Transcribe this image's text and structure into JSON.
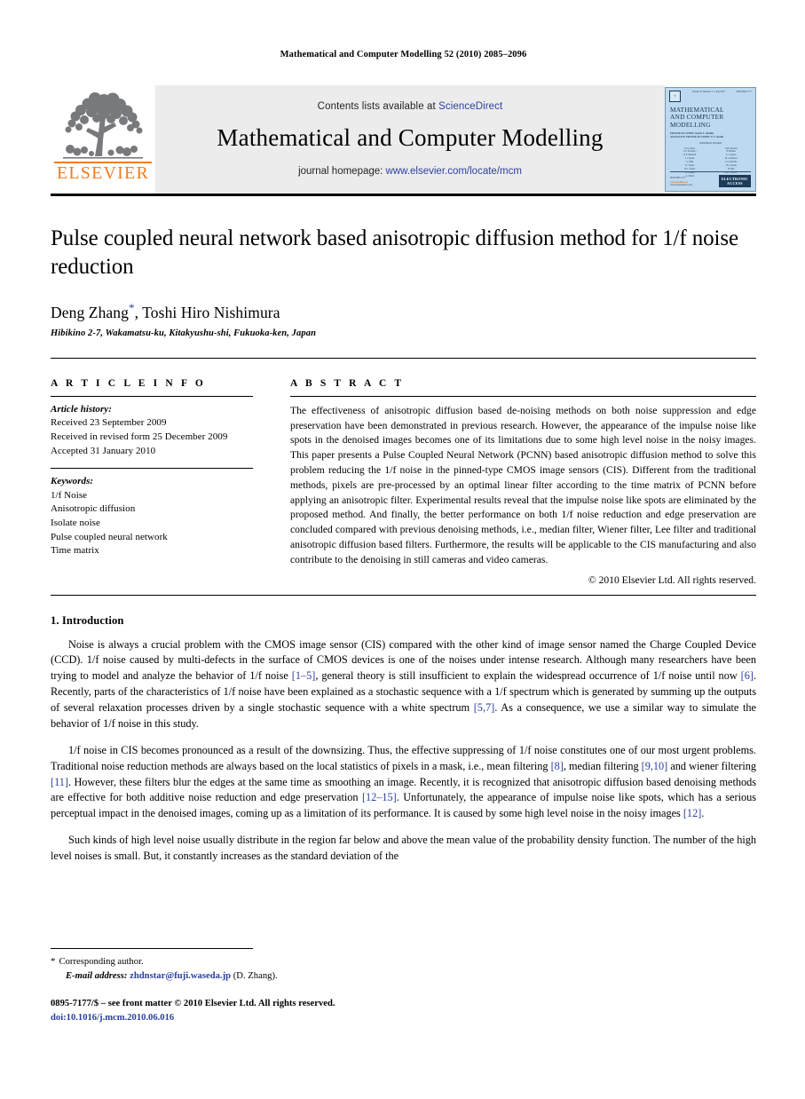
{
  "running_head": "Mathematical and Computer Modelling 52 (2010) 2085–2096",
  "masthead": {
    "publisher_name": "ELSEVIER",
    "contents_prefix": "Contents lists available at ",
    "contents_link": "ScienceDirect",
    "journal_name": "Mathematical and Computer Modelling",
    "homepage_prefix": "journal homepage: ",
    "homepage_url": "www.elsevier.com/locate/mcm",
    "accent_color": "#2b3f9e",
    "elsevier_orange": "#F47A1F",
    "band_color": "#ececec"
  },
  "cover": {
    "volume_line": "Volume 52 Numbers 1–2  July 2010",
    "issn_top": "ISSN 0895-7177",
    "title_lines": [
      "MATHEMATICAL",
      "AND COMPUTER",
      "MODELLING"
    ],
    "editor_line_1": "EDITOR-IN-CHIEF: Kevin S. Shahin",
    "editor_line_2": "ASSOCIATE EDITOR-IN-CHIEF: E.Y. Rodin",
    "board_header": "EDITORIAL BOARD",
    "board_names": [
      "H.A. Eiselt",
      "A.B. Stevens",
      "L.F. Escudero",
      "P. Hansen",
      "R.E. Burkard",
      "G. Laporte",
      "J. Current",
      "M. Gendreau",
      "S. Salhi",
      "C.S. ReVelle",
      "D. Tuzun",
      "J.R. Current",
      "B.C. Tansel",
      "H. Min",
      "M. Daskin",
      "R.L. Church",
      "A. Marin",
      "F. Plastria"
    ],
    "issn_bottom_line_1": "ISSN 0895-7177",
    "issn_bottom_line_2": "ScienceDirect",
    "issn_bottom_line_3": "www.sciencedirect.com",
    "badge_line_1": "ELECTRONIC",
    "badge_line_2": "ACCESS",
    "bg_color": "#bcd9ef"
  },
  "article": {
    "title": "Pulse coupled neural network based anisotropic diffusion method for 1/f noise reduction",
    "authors": "Deng Zhang",
    "authors_suffix": ", Toshi Hiro Nishimura",
    "corresponding_marker": "*",
    "affiliation": "Hibikino 2-7, Wakamatsu-ku, Kitakyushu-shi, Fukuoka-ken, Japan"
  },
  "article_info": {
    "heading": "A R T I C L E    I N F O",
    "history_label": "Article history:",
    "history": [
      "Received 23 September 2009",
      "Received in revised form 25 December 2009",
      "Accepted 31 January 2010"
    ],
    "keywords_label": "Keywords:",
    "keywords": [
      "1/f Noise",
      "Anisotropic diffusion",
      "Isolate noise",
      "Pulse coupled neural network",
      "Time matrix"
    ]
  },
  "abstract": {
    "heading": "A B S T R A C T",
    "text": "The effectiveness of anisotropic diffusion based de-noising methods on both noise suppression and edge preservation have been demonstrated in previous research. However, the appearance of the impulse noise like spots in the denoised images becomes one of its limitations due to some high level noise in the noisy images. This paper presents a Pulse Coupled Neural Network (PCNN) based anisotropic diffusion method to solve this problem reducing the 1/f noise in the pinned-type CMOS image sensors (CIS). Different from the traditional methods, pixels are pre-processed by an optimal linear filter according to the time matrix of PCNN before applying an anisotropic filter. Experimental results reveal that the impulse noise like spots are eliminated by the proposed method. And finally, the better performance on both 1/f noise reduction and edge preservation are concluded compared with previous denoising methods, i.e., median filter, Wiener filter, Lee filter and traditional anisotropic diffusion based filters. Furthermore, the results will be applicable to the CIS manufacturing and also contribute to the denoising in still cameras and video cameras.",
    "copyright": "© 2010 Elsevier Ltd. All rights reserved."
  },
  "body": {
    "section_title": "1. Introduction",
    "paragraph_1_a": "Noise is always a crucial problem with the CMOS image sensor (CIS) compared with the other kind of image sensor named the Charge Coupled Device (CCD). 1/f noise caused by multi-defects in the surface of CMOS devices is one of the noises under intense research. Although many researchers have been trying to model and analyze the behavior of 1/f noise ",
    "p1_cite_1": "[1–5]",
    "paragraph_1_b": ", general theory is still insufficient to explain the widespread occurrence of 1/f noise until now ",
    "p1_cite_2": "[6]",
    "paragraph_1_c": ". Recently, parts of the characteristics of 1/f noise have been explained as a stochastic sequence with a 1/f spectrum which is generated by summing up the outputs of several relaxation processes driven by a single stochastic sequence with a white spectrum ",
    "p1_cite_3": "[5,7]",
    "paragraph_1_d": ". As a consequence, we use a similar way to simulate the behavior of 1/f noise in this study.",
    "paragraph_2_a": "1/f noise in CIS becomes pronounced as a result of the downsizing. Thus, the effective suppressing of 1/f noise constitutes one of our most urgent problems. Traditional noise reduction methods are always based on the local statistics of pixels in a mask, i.e., mean filtering ",
    "p2_cite_1": "[8]",
    "paragraph_2_b": ", median filtering ",
    "p2_cite_2": "[9,10]",
    "paragraph_2_c": " and wiener filtering ",
    "p2_cite_3": "[11]",
    "paragraph_2_d": ". However, these filters blur the edges at the same time as smoothing an image. Recently, it is recognized that anisotropic diffusion based denoising methods are effective for both additive noise reduction and edge preservation ",
    "p2_cite_4": "[12–15]",
    "paragraph_2_e": ". Unfortunately, the appearance of impulse noise like spots, which has a serious perceptual impact in the denoised images, coming up as a limitation of its performance. It is caused by some high level noise in the noisy images ",
    "p2_cite_5": "[12]",
    "paragraph_2_f": ".",
    "paragraph_3": "Such kinds of high level noise usually distribute in the region far below and above the mean value of the probability density function. The number of the high level noises is small. But, it constantly increases as the standard deviation of the"
  },
  "footer": {
    "corresponding_marker": "*",
    "corresponding_text": "Corresponding author.",
    "email_label": "E-mail address:",
    "email": "zhdnstar@fuji.waseda.jp",
    "email_owner": "(D. Zhang).",
    "issn_line": "0895-7177/$ – see front matter © 2010 Elsevier Ltd. All rights reserved.",
    "doi_prefix": "doi:",
    "doi": "10.1016/j.mcm.2010.06.016"
  }
}
